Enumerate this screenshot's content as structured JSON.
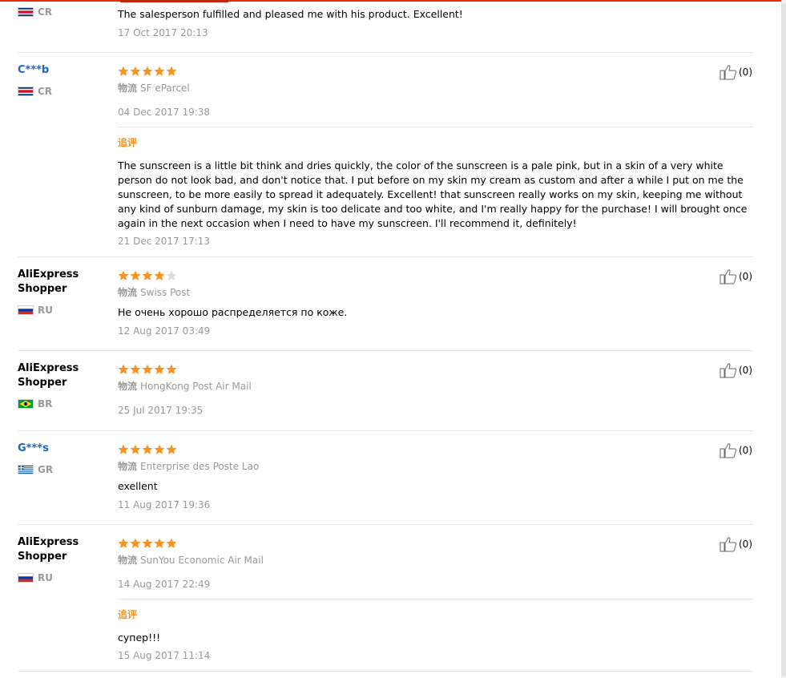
{
  "reviews": [
    {
      "country": "CR",
      "text": "The salesperson fulfilled and pleased me with his product. Excellent!",
      "date": "17 Oct 2017 20:13"
    },
    {
      "user": "C***b",
      "country": "CR",
      "rating": 5,
      "logistics_label": "物流",
      "logistics": "SF eParcel",
      "date": "04 Dec 2017 19:38",
      "followup_label": "追评",
      "followup_text": "The sunscreen is a little bit think and dries quickly, the color of the sunscreen is a pale pink, but in a skin of a very white person do not look bad, and don't notice that. I put before on my skin my cream as custom and after a while I put on me the sunscreen, to be more easily to spread it adequately. Excellent! that sunscreen really works on my skin, keeping me without any kind of sunburn damage, my skin is too delicate and too white, and I'm really happy for the purchase! I will brought once again in the next occasion when I need to have my sunscreen. I'll recommend it, definitely!",
      "followup_date": "21 Dec 2017 17:13",
      "helpful": "(0)"
    },
    {
      "user": "AliExpress Shopper",
      "country": "RU",
      "rating": 4,
      "logistics_label": "物流",
      "logistics": "Swiss Post",
      "text": "Не очень хорошо распределяется по коже.",
      "date": "12 Aug 2017 03:49",
      "helpful": "(0)"
    },
    {
      "user": "AliExpress Shopper",
      "country": "BR",
      "rating": 5,
      "logistics_label": "物流",
      "logistics": "HongKong Post Air Mail",
      "date": "25 Jul 2017 19:35",
      "helpful": "(0)"
    },
    {
      "user": "G***s",
      "country": "GR",
      "rating": 5,
      "logistics_label": "物流",
      "logistics": "Enterprise des Poste Lao",
      "text": "exellent",
      "date": "11 Aug 2017 19:36",
      "helpful": "(0)"
    },
    {
      "user": "AliExpress Shopper",
      "country": "RU",
      "rating": 5,
      "logistics_label": "物流",
      "logistics": "SunYou Economic Air Mail",
      "date": "14 Aug 2017 22:49",
      "followup_label": "追评",
      "followup_text": "супер!!!",
      "followup_date": "15 Aug 2017 11:14",
      "helpful": "(0)"
    }
  ],
  "colors": {
    "accent": "#e62e04",
    "star": "#f7931e",
    "star_empty": "#dddddd",
    "masked_user": "#1a66c0",
    "muted": "#999999"
  },
  "icons": {
    "helpful": "thumbs-up-icon",
    "rating": "star-icon"
  }
}
